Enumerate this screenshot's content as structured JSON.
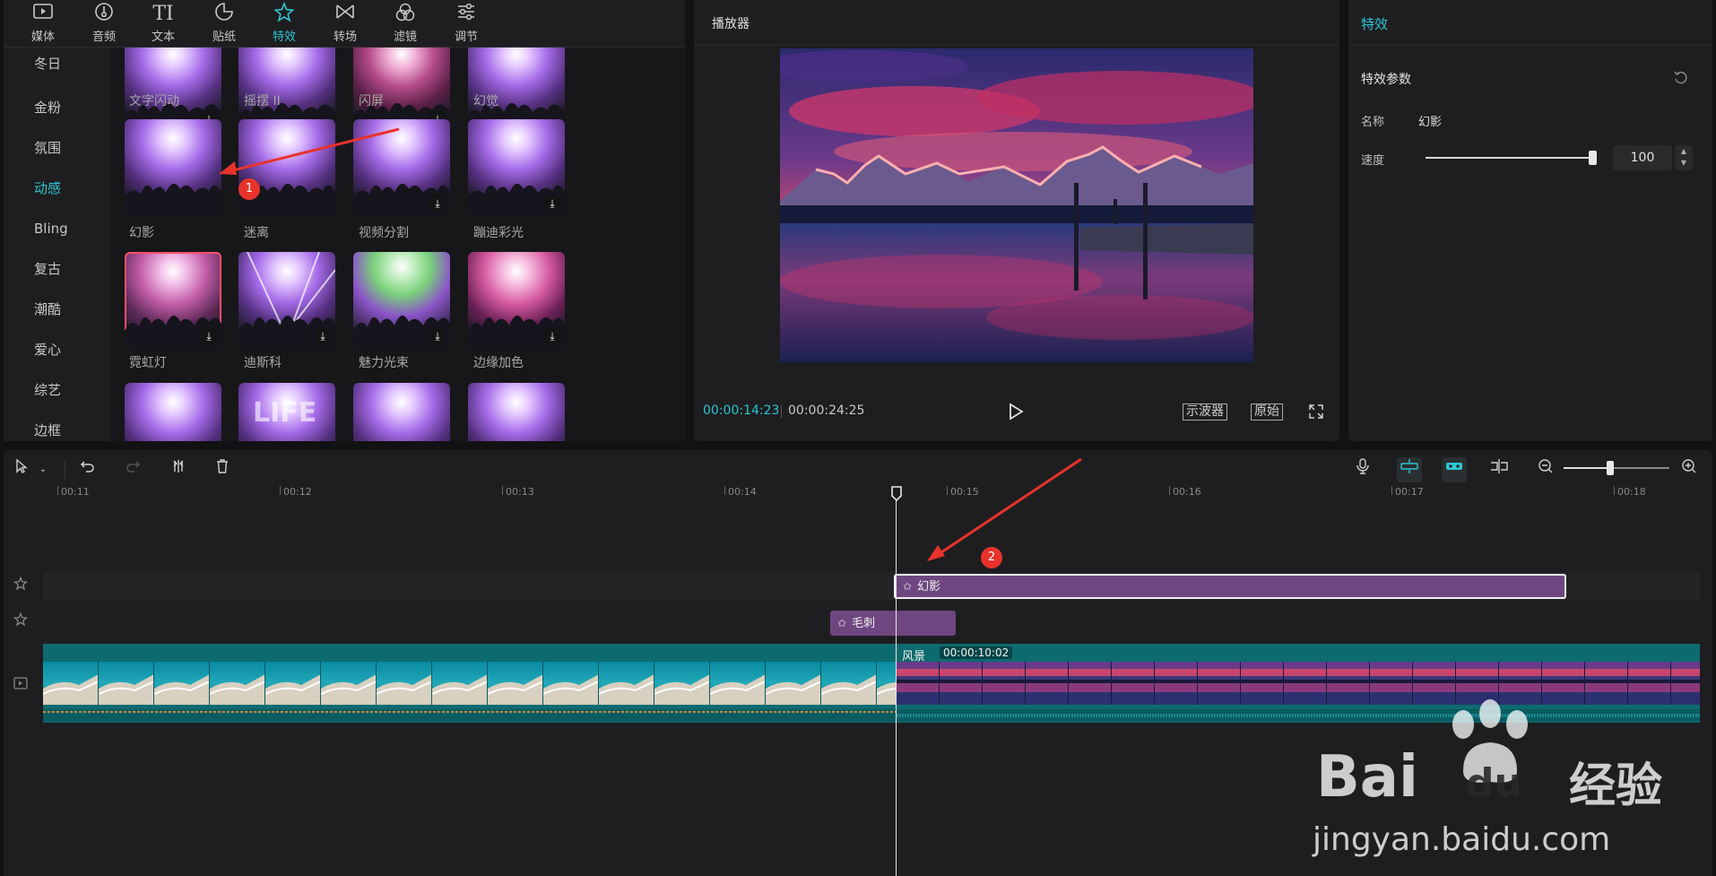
{
  "toolbar": {
    "tabs": [
      {
        "label": "媒体",
        "icon": "media-icon"
      },
      {
        "label": "音频",
        "icon": "audio-icon"
      },
      {
        "label": "文本",
        "icon": "text-icon"
      },
      {
        "label": "贴纸",
        "icon": "sticker-icon"
      },
      {
        "label": "特效",
        "icon": "effects-icon"
      },
      {
        "label": "转场",
        "icon": "transition-icon"
      },
      {
        "label": "滤镜",
        "icon": "filter-icon"
      },
      {
        "label": "调节",
        "icon": "adjust-icon"
      }
    ],
    "active_tab": "特效"
  },
  "categories": {
    "items": [
      "冬日",
      "金粉",
      "氛围",
      "动感",
      "Bling",
      "复古",
      "潮酷",
      "爱心",
      "综艺",
      "边框"
    ],
    "active": "动感"
  },
  "effects_grid": {
    "row0": [
      "文字闪动",
      "摇摆 II",
      "闪屏",
      "幻觉"
    ],
    "row1": [
      "幻影",
      "迷离",
      "视频分割",
      "蹦迪彩光"
    ],
    "row2": [
      "霓虹灯",
      "迪斯科",
      "魅力光束",
      "边缘加色"
    ],
    "row3_thumb_text": "LIFE"
  },
  "player": {
    "title": "播放器",
    "current_time": "00:00:14:23",
    "total_time": "00:00:24:25",
    "scope_button": "示波器",
    "ratio_button": "原始"
  },
  "inspector": {
    "title": "特效",
    "section_title": "特效参数",
    "name_label": "名称",
    "name_value": "幻影",
    "speed_label": "速度",
    "speed_value": "100",
    "speed_fraction": 1.0
  },
  "timeline": {
    "ruler_ticks": [
      "00:11",
      "00:12",
      "00:13",
      "00:14",
      "00:15",
      "00:16",
      "00:17",
      "00:18"
    ],
    "effect_clip_main": "幻影",
    "effect_clip_second": "毛刺",
    "video_clip_name": "风景",
    "video_clip_duration": "00:00:10:02",
    "zoom_fraction": 0.44
  },
  "annotations": {
    "badge1": "1",
    "badge2": "2"
  },
  "watermark": {
    "brand": "Bai",
    "brand2": "du",
    "cn": "经验",
    "url": "jingyan.baidu.com"
  },
  "colors": {
    "accent": "#2fc5d1",
    "clip_purple": "#6e4781",
    "video_teal": "#0d6b6f",
    "annotation_red": "#e8332c"
  }
}
